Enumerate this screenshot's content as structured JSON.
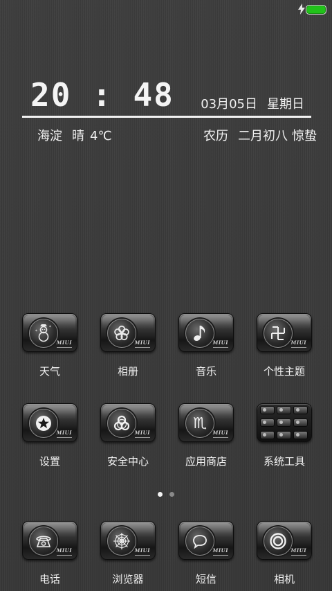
{
  "status_bar": {
    "charging_icon": "lightning-bolt",
    "battery_color": "#21c21a"
  },
  "clock_widget": {
    "time": "20 : 48",
    "date": "03月05日",
    "weekday": "星期日",
    "location": "海淀",
    "weather": "晴",
    "temperature": "4℃",
    "lunar_label": "农历",
    "lunar_date": "二月初八",
    "solar_term": "惊蛰"
  },
  "apps": [
    {
      "label": "天气",
      "icon": "snowman-icon"
    },
    {
      "label": "相册",
      "icon": "flower-icon"
    },
    {
      "label": "音乐",
      "icon": "music-note-icon"
    },
    {
      "label": "个性主题",
      "icon": "swastika-icon"
    },
    {
      "label": "设置",
      "icon": "star-icon"
    },
    {
      "label": "安全中心",
      "icon": "biohazard-icon"
    },
    {
      "label": "应用商店",
      "icon": "scorpio-icon"
    },
    {
      "label": "系统工具",
      "icon": "folder-grid-icon"
    },
    {
      "label": "电话",
      "icon": "telephone-icon"
    },
    {
      "label": "浏览器",
      "icon": "spiderweb-icon"
    },
    {
      "label": "短信",
      "icon": "speech-bubble-icon"
    },
    {
      "label": "相机",
      "icon": "lens-icon"
    }
  ],
  "icon_brand": "MIUI",
  "pager": {
    "pages": 2,
    "current": 1
  }
}
